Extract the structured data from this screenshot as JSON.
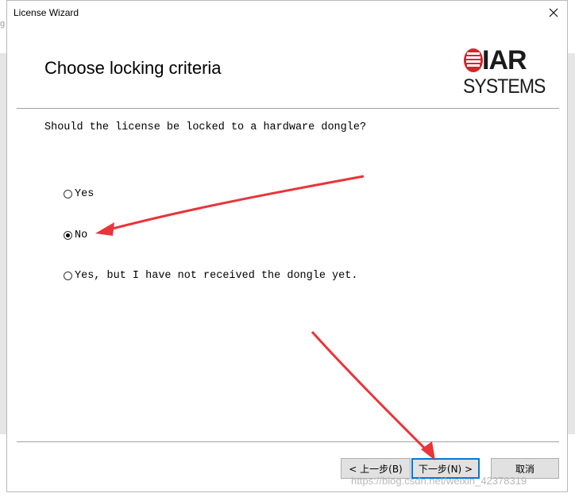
{
  "window": {
    "title": "License Wizard",
    "close_glyph": "✕",
    "close_icon": "close-icon"
  },
  "background": {
    "left_fragment": "g"
  },
  "header": {
    "title": "Choose locking criteria",
    "logo": {
      "name": "IAR SYSTEMS",
      "line1": "IAR",
      "line2": "SYSTEMS"
    }
  },
  "content": {
    "question": "Should the license be locked to a hardware dongle?",
    "options": [
      {
        "label": "Yes",
        "checked": false
      },
      {
        "label": "No",
        "checked": true
      },
      {
        "label": "Yes, but I have not received the dongle yet.",
        "checked": false
      }
    ]
  },
  "footer": {
    "back_label": "< 上一步(B)",
    "next_label": "下一步(N) >",
    "cancel_label": "取消",
    "default_button": "next"
  },
  "watermark": "https://blog.csdn.net/weixin_42378319",
  "colors": {
    "annotation_arrow": "#e8343a",
    "accent": "#0078d7",
    "button_face": "#e1e1e1"
  }
}
